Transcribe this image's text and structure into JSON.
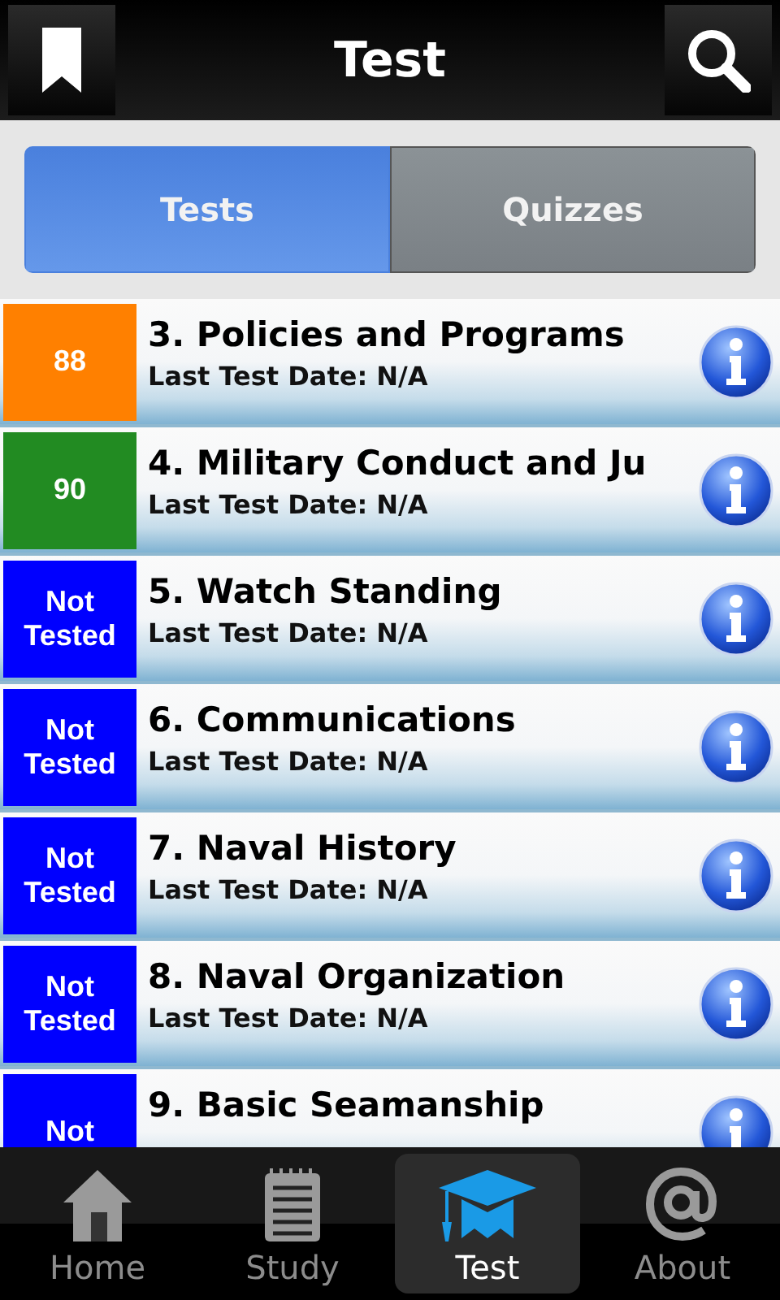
{
  "header": {
    "title": "Test"
  },
  "segments": [
    {
      "label": "Tests",
      "selected": true
    },
    {
      "label": "Quizzes",
      "selected": false
    }
  ],
  "rows": [
    {
      "score": "88",
      "color": "#ff8000",
      "title": "3. Policies and Programs",
      "subtitle": "Last Test Date: N/A"
    },
    {
      "score": "90",
      "color": "#228b22",
      "title": "4. Military Conduct and Ju",
      "subtitle": "Last Test Date: N/A"
    },
    {
      "score": "Not Tested",
      "color": "#0000ff",
      "title": "5. Watch Standing",
      "subtitle": "Last Test Date: N/A"
    },
    {
      "score": "Not Tested",
      "color": "#0000ff",
      "title": "6. Communications",
      "subtitle": "Last Test Date: N/A"
    },
    {
      "score": "Not Tested",
      "color": "#0000ff",
      "title": "7. Naval History",
      "subtitle": "Last Test Date: N/A"
    },
    {
      "score": "Not Tested",
      "color": "#0000ff",
      "title": "8. Naval Organization",
      "subtitle": "Last Test Date: N/A"
    },
    {
      "score": "Not",
      "color": "#0000ff",
      "title": "9. Basic Seamanship"
    }
  ],
  "tabbar": [
    {
      "kind": "home",
      "label": "Home",
      "selected": false
    },
    {
      "kind": "study",
      "label": "Study",
      "selected": false
    },
    {
      "kind": "test",
      "label": "Test",
      "selected": true
    },
    {
      "kind": "about",
      "label": "About",
      "selected": false
    }
  ]
}
